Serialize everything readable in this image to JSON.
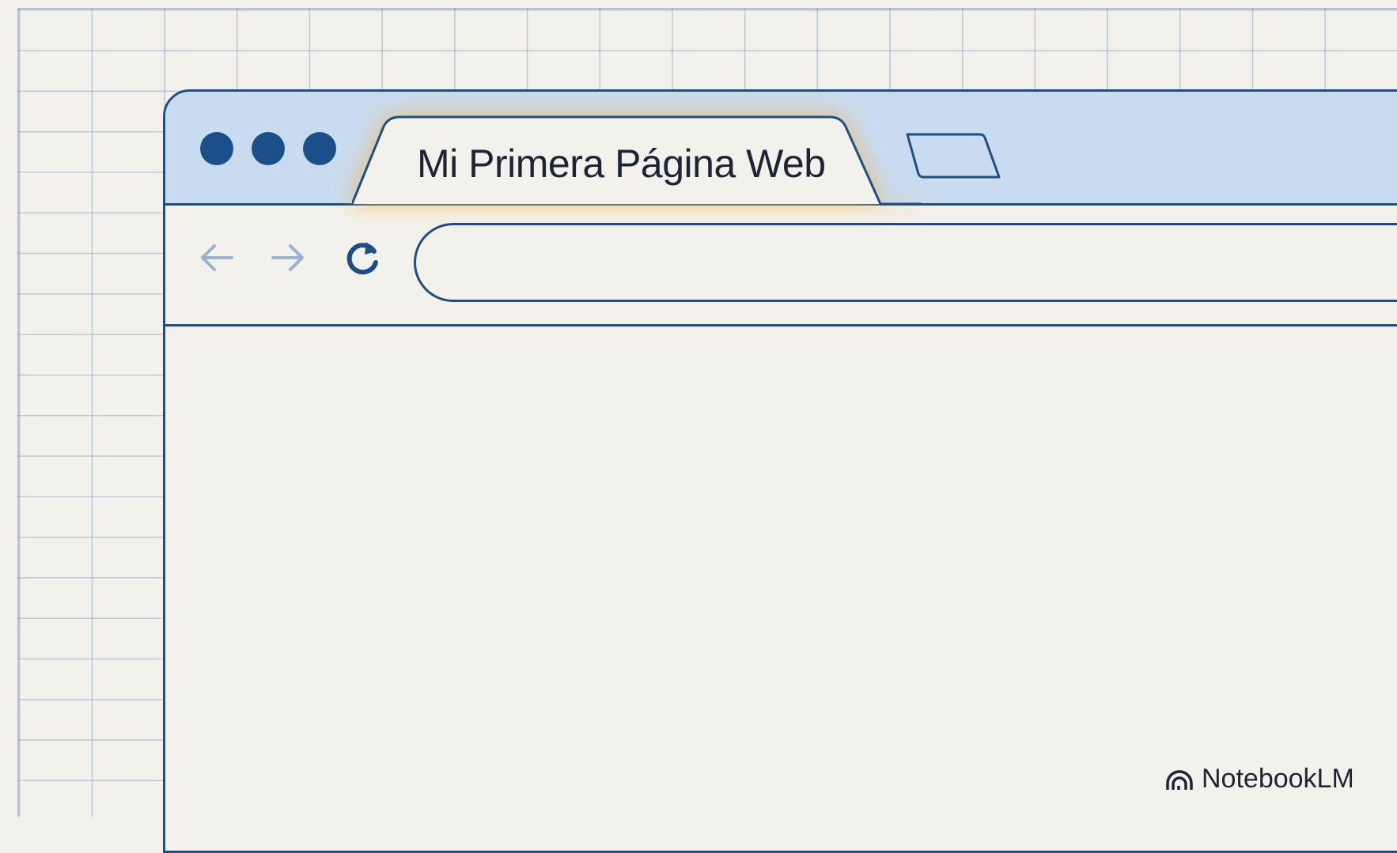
{
  "browser": {
    "tab": {
      "title": "Mi Primera Página Web"
    },
    "address_bar": {
      "value": ""
    },
    "icons": {
      "window_controls": "dot-icon",
      "back": "arrow-left-icon",
      "forward": "arrow-right-icon",
      "reload": "reload-icon",
      "new_tab": "new-tab-icon"
    }
  },
  "watermark": {
    "text": "NotebookLM",
    "icon": "notebooklm-logo-icon"
  },
  "colors": {
    "outline": "#1d4f86",
    "titlebar": "#c9dbef",
    "background": "#f2f1ec",
    "tab_glow": "#f0b446",
    "nav_disabled": "#9bb3cf"
  }
}
